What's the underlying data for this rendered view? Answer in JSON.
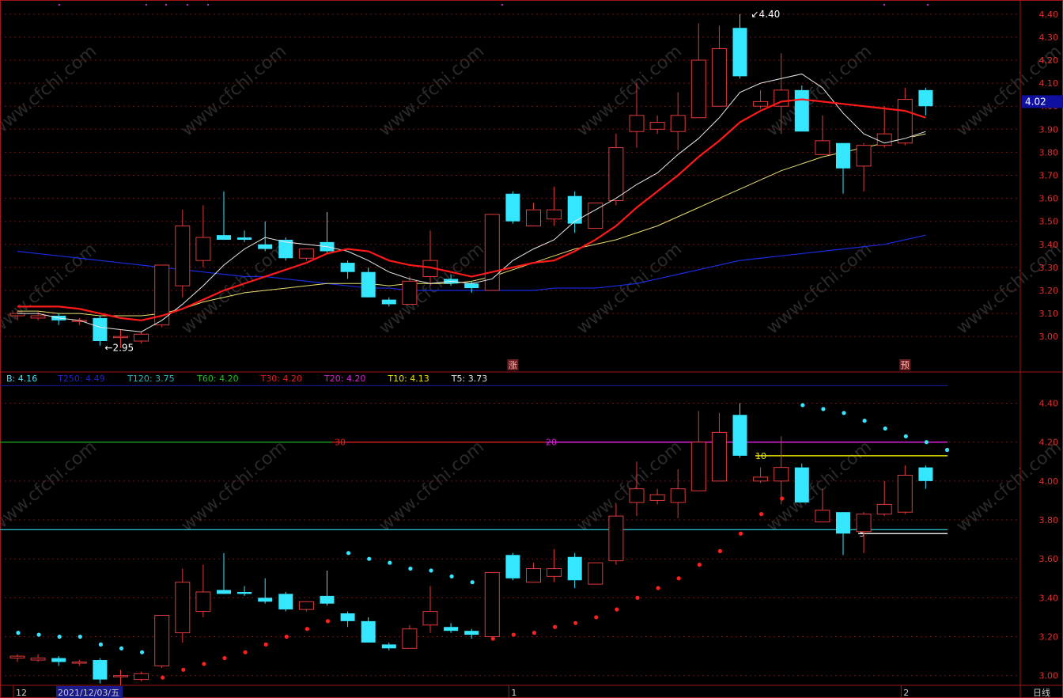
{
  "chart_data": [
    {
      "type": "candlestick",
      "panel": "main",
      "ylim": [
        2.87,
        4.42
      ],
      "yticks": [
        "4.40",
        "4.30",
        "4.20",
        "4.10",
        "4.00",
        "3.90",
        "3.80",
        "3.70",
        "3.60",
        "3.50",
        "3.40",
        "3.30",
        "3.20",
        "3.10",
        "3.00"
      ],
      "current_price": "4.02",
      "high_label": "4.40",
      "low_label": "2.95",
      "markers": [
        "涨",
        "预"
      ],
      "candles": [
        {
          "o": 3.09,
          "h": 3.11,
          "l": 3.07,
          "c": 3.1
        },
        {
          "o": 3.08,
          "h": 3.11,
          "l": 3.07,
          "c": 3.09
        },
        {
          "o": 3.09,
          "h": 3.1,
          "l": 3.05,
          "c": 3.07
        },
        {
          "o": 3.07,
          "h": 3.08,
          "l": 3.05,
          "c": 3.07
        },
        {
          "o": 3.08,
          "h": 3.09,
          "l": 2.96,
          "c": 2.98
        },
        {
          "o": 3.0,
          "h": 3.03,
          "l": 2.95,
          "c": 3.0
        },
        {
          "o": 2.98,
          "h": 3.02,
          "l": 2.97,
          "c": 3.01
        },
        {
          "o": 3.05,
          "h": 3.31,
          "l": 3.04,
          "c": 3.31
        },
        {
          "o": 3.22,
          "h": 3.55,
          "l": 3.17,
          "c": 3.48
        },
        {
          "o": 3.33,
          "h": 3.57,
          "l": 3.3,
          "c": 3.43
        },
        {
          "o": 3.44,
          "h": 3.63,
          "l": 3.42,
          "c": 3.42
        },
        {
          "o": 3.43,
          "h": 3.46,
          "l": 3.41,
          "c": 3.42
        },
        {
          "o": 3.4,
          "h": 3.5,
          "l": 3.37,
          "c": 3.38
        },
        {
          "o": 3.42,
          "h": 3.43,
          "l": 3.33,
          "c": 3.34
        },
        {
          "o": 3.34,
          "h": 3.38,
          "l": 3.33,
          "c": 3.38
        },
        {
          "o": 3.41,
          "h": 3.54,
          "l": 3.36,
          "c": 3.37
        },
        {
          "o": 3.32,
          "h": 3.33,
          "l": 3.25,
          "c": 3.28
        },
        {
          "o": 3.28,
          "h": 3.3,
          "l": 3.17,
          "c": 3.17
        },
        {
          "o": 3.16,
          "h": 3.17,
          "l": 3.13,
          "c": 3.14
        },
        {
          "o": 3.14,
          "h": 3.26,
          "l": 3.14,
          "c": 3.24
        },
        {
          "o": 3.26,
          "h": 3.46,
          "l": 3.22,
          "c": 3.33
        },
        {
          "o": 3.25,
          "h": 3.27,
          "l": 3.22,
          "c": 3.23
        },
        {
          "o": 3.23,
          "h": 3.24,
          "l": 3.19,
          "c": 3.21
        },
        {
          "o": 3.2,
          "h": 3.53,
          "l": 3.2,
          "c": 3.53
        },
        {
          "o": 3.62,
          "h": 3.63,
          "l": 3.49,
          "c": 3.5
        },
        {
          "o": 3.48,
          "h": 3.58,
          "l": 3.48,
          "c": 3.55
        },
        {
          "o": 3.51,
          "h": 3.65,
          "l": 3.48,
          "c": 3.55
        },
        {
          "o": 3.61,
          "h": 3.63,
          "l": 3.45,
          "c": 3.49
        },
        {
          "o": 3.47,
          "h": 3.58,
          "l": 3.47,
          "c": 3.58
        },
        {
          "o": 3.59,
          "h": 3.88,
          "l": 3.57,
          "c": 3.82
        },
        {
          "o": 3.89,
          "h": 4.1,
          "l": 3.82,
          "c": 3.96
        },
        {
          "o": 3.9,
          "h": 3.96,
          "l": 3.88,
          "c": 3.93
        },
        {
          "o": 3.89,
          "h": 4.06,
          "l": 3.81,
          "c": 3.96
        },
        {
          "o": 3.95,
          "h": 4.36,
          "l": 3.95,
          "c": 4.2
        },
        {
          "o": 4.0,
          "h": 4.35,
          "l": 4.0,
          "c": 4.25
        },
        {
          "o": 4.34,
          "h": 4.4,
          "l": 4.12,
          "c": 4.13
        },
        {
          "o": 4.0,
          "h": 4.07,
          "l": 3.99,
          "c": 4.02
        },
        {
          "o": 4.0,
          "h": 4.23,
          "l": 3.88,
          "c": 4.07
        },
        {
          "o": 4.07,
          "h": 4.09,
          "l": 3.89,
          "c": 3.89
        },
        {
          "o": 3.79,
          "h": 3.96,
          "l": 3.79,
          "c": 3.85
        },
        {
          "o": 3.84,
          "h": 3.84,
          "l": 3.62,
          "c": 3.73
        },
        {
          "o": 3.74,
          "h": 3.84,
          "l": 3.63,
          "c": 3.83
        },
        {
          "o": 3.83,
          "h": 4.0,
          "l": 3.82,
          "c": 3.88
        },
        {
          "o": 3.84,
          "h": 4.08,
          "l": 3.83,
          "c": 4.03
        },
        {
          "o": 4.07,
          "h": 4.08,
          "l": 3.96,
          "c": 4.0
        }
      ],
      "ma_white": [
        3.1,
        3.1,
        3.08,
        3.07,
        3.04,
        3.03,
        3.02,
        3.07,
        3.14,
        3.22,
        3.31,
        3.38,
        3.43,
        3.41,
        3.4,
        3.39,
        3.37,
        3.33,
        3.28,
        3.25,
        3.23,
        3.24,
        3.23,
        3.25,
        3.33,
        3.38,
        3.42,
        3.5,
        3.55,
        3.6,
        3.66,
        3.71,
        3.79,
        3.86,
        3.95,
        4.06,
        4.1,
        4.12,
        4.14,
        4.08,
        3.97,
        3.88,
        3.84,
        3.86,
        3.89
      ],
      "ma_red": [
        3.13,
        3.13,
        3.13,
        3.12,
        3.1,
        3.08,
        3.07,
        3.09,
        3.12,
        3.16,
        3.2,
        3.23,
        3.26,
        3.29,
        3.32,
        3.36,
        3.38,
        3.37,
        3.33,
        3.31,
        3.3,
        3.28,
        3.26,
        3.28,
        3.3,
        3.32,
        3.33,
        3.37,
        3.42,
        3.48,
        3.56,
        3.63,
        3.7,
        3.78,
        3.85,
        3.93,
        3.98,
        4.02,
        4.03,
        4.02,
        4.01,
        4.0,
        3.99,
        3.98,
        3.95
      ],
      "ma_yellow": [
        3.11,
        3.11,
        3.1,
        3.1,
        3.09,
        3.09,
        3.09,
        3.1,
        3.12,
        3.15,
        3.17,
        3.19,
        3.2,
        3.21,
        3.22,
        3.23,
        3.23,
        3.23,
        3.22,
        3.23,
        3.23,
        3.23,
        3.24,
        3.26,
        3.29,
        3.32,
        3.35,
        3.38,
        3.4,
        3.42,
        3.45,
        3.48,
        3.52,
        3.56,
        3.6,
        3.64,
        3.68,
        3.72,
        3.75,
        3.78,
        3.8,
        3.82,
        3.84,
        3.86,
        3.88
      ],
      "ma_blue": [
        3.37,
        3.36,
        3.35,
        3.34,
        3.33,
        3.32,
        3.31,
        3.3,
        3.29,
        3.28,
        3.27,
        3.26,
        3.26,
        3.25,
        3.24,
        3.23,
        3.22,
        3.21,
        3.21,
        3.2,
        3.2,
        3.2,
        3.2,
        3.2,
        3.2,
        3.2,
        3.21,
        3.21,
        3.21,
        3.22,
        3.23,
        3.25,
        3.27,
        3.29,
        3.31,
        3.33,
        3.34,
        3.35,
        3.36,
        3.37,
        3.38,
        3.39,
        3.4,
        3.42,
        3.44
      ]
    },
    {
      "type": "candlestick",
      "panel": "lower",
      "ylim": [
        2.95,
        4.52
      ],
      "yticks": [
        "4.40",
        "4.20",
        "4.00",
        "3.80",
        "3.60",
        "3.40",
        "3.20",
        "3.00"
      ],
      "legend": [
        {
          "text": "B: 4.16",
          "color": "#35e6ff"
        },
        {
          "text": "T250: 4.49",
          "color": "#2222cc"
        },
        {
          "text": "T120: 3.75",
          "color": "#29b6c0"
        },
        {
          "text": "T60: 4.20",
          "color": "#20c020"
        },
        {
          "text": "T30: 4.20",
          "color": "#dd2020"
        },
        {
          "text": "T20: 4.20",
          "color": "#d020d0"
        },
        {
          "text": "T10: 4.13",
          "color": "#e8e000"
        },
        {
          "text": "T5: 3.73",
          "color": "#e0e0e0"
        }
      ],
      "hlines": [
        {
          "value": 4.49,
          "color": "#1c1caa"
        },
        {
          "value": 4.2,
          "color": "#20a020",
          "label": ""
        },
        {
          "value": 4.13,
          "color": "#e8e000"
        },
        {
          "value": 3.75,
          "color": "#29b6c0"
        },
        {
          "value": 3.73,
          "color": "#e0e0e0"
        }
      ],
      "line_labels": [
        "30",
        "20",
        "10",
        "5"
      ],
      "sar": [
        {
          "v": 3.22,
          "up": false
        },
        {
          "v": 3.21,
          "up": false
        },
        {
          "v": 3.2,
          "up": false
        },
        {
          "v": 3.2,
          "up": false
        },
        {
          "v": 3.16,
          "up": false
        },
        {
          "v": 3.14,
          "up": false
        },
        {
          "v": 3.12,
          "up": false
        },
        {
          "v": 2.99,
          "up": true
        },
        {
          "v": 3.03,
          "up": true
        },
        {
          "v": 3.06,
          "up": true
        },
        {
          "v": 3.09,
          "up": true
        },
        {
          "v": 3.12,
          "up": true
        },
        {
          "v": 3.16,
          "up": true
        },
        {
          "v": 3.2,
          "up": true
        },
        {
          "v": 3.24,
          "up": true
        },
        {
          "v": 3.28,
          "up": true
        },
        {
          "v": 3.63,
          "up": false
        },
        {
          "v": 3.6,
          "up": false
        },
        {
          "v": 3.58,
          "up": false
        },
        {
          "v": 3.55,
          "up": false
        },
        {
          "v": 3.54,
          "up": false
        },
        {
          "v": 3.51,
          "up": false
        },
        {
          "v": 3.48,
          "up": false
        },
        {
          "v": 3.19,
          "up": true
        },
        {
          "v": 3.21,
          "up": true
        },
        {
          "v": 3.22,
          "up": true
        },
        {
          "v": 3.25,
          "up": true
        },
        {
          "v": 3.27,
          "up": true
        },
        {
          "v": 3.3,
          "up": true
        },
        {
          "v": 3.34,
          "up": true
        },
        {
          "v": 3.4,
          "up": true
        },
        {
          "v": 3.45,
          "up": true
        },
        {
          "v": 3.5,
          "up": true
        },
        {
          "v": 3.57,
          "up": true
        },
        {
          "v": 3.64,
          "up": true
        },
        {
          "v": 3.73,
          "up": true
        },
        {
          "v": 3.83,
          "up": true
        },
        {
          "v": 3.91,
          "up": true
        },
        {
          "v": 4.39,
          "up": false
        },
        {
          "v": 4.37,
          "up": false
        },
        {
          "v": 4.35,
          "up": false
        },
        {
          "v": 4.31,
          "up": false
        },
        {
          "v": 4.27,
          "up": false
        },
        {
          "v": 4.23,
          "up": false
        },
        {
          "v": 4.2,
          "up": false
        },
        {
          "v": 4.16,
          "up": false
        }
      ]
    }
  ],
  "x_axis": {
    "labels": [
      {
        "text": "12",
        "index": 0
      },
      {
        "text": "1",
        "index": 24
      },
      {
        "text": "2",
        "index": 43
      }
    ],
    "cursor_date": "2021/12/03/五",
    "period": "日线"
  },
  "watermark": "www.cfchi.com",
  "colors": {
    "up": "#e23a3a",
    "down": "#35e6ff",
    "grid": "#7a1010",
    "axis": "#a01818"
  }
}
